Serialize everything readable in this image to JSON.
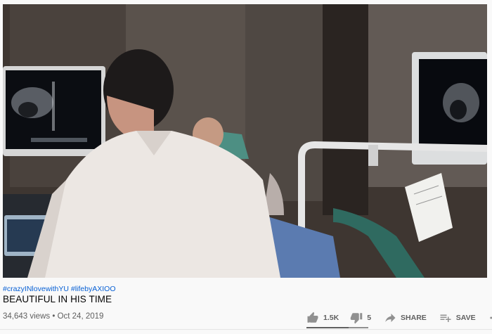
{
  "video": {
    "hashtags": [
      "#crazyINlovewithYU",
      "#lifebyAXIOO"
    ],
    "title": "BEAUTIFUL IN HIS TIME",
    "views": "34,643 views",
    "separator": "•",
    "date": "Oct 24, 2019"
  },
  "actions": {
    "like_count": "1.5K",
    "dislike_count": "5",
    "share_label": "SHARE",
    "save_label": "SAVE"
  },
  "icons": [
    "thumb-up-icon",
    "thumb-down-icon",
    "share-icon",
    "playlist-add-icon",
    "more-icon"
  ],
  "colors": {
    "hashtag": "#065fd4",
    "secondary_text": "#606060",
    "icon": "#909090"
  }
}
